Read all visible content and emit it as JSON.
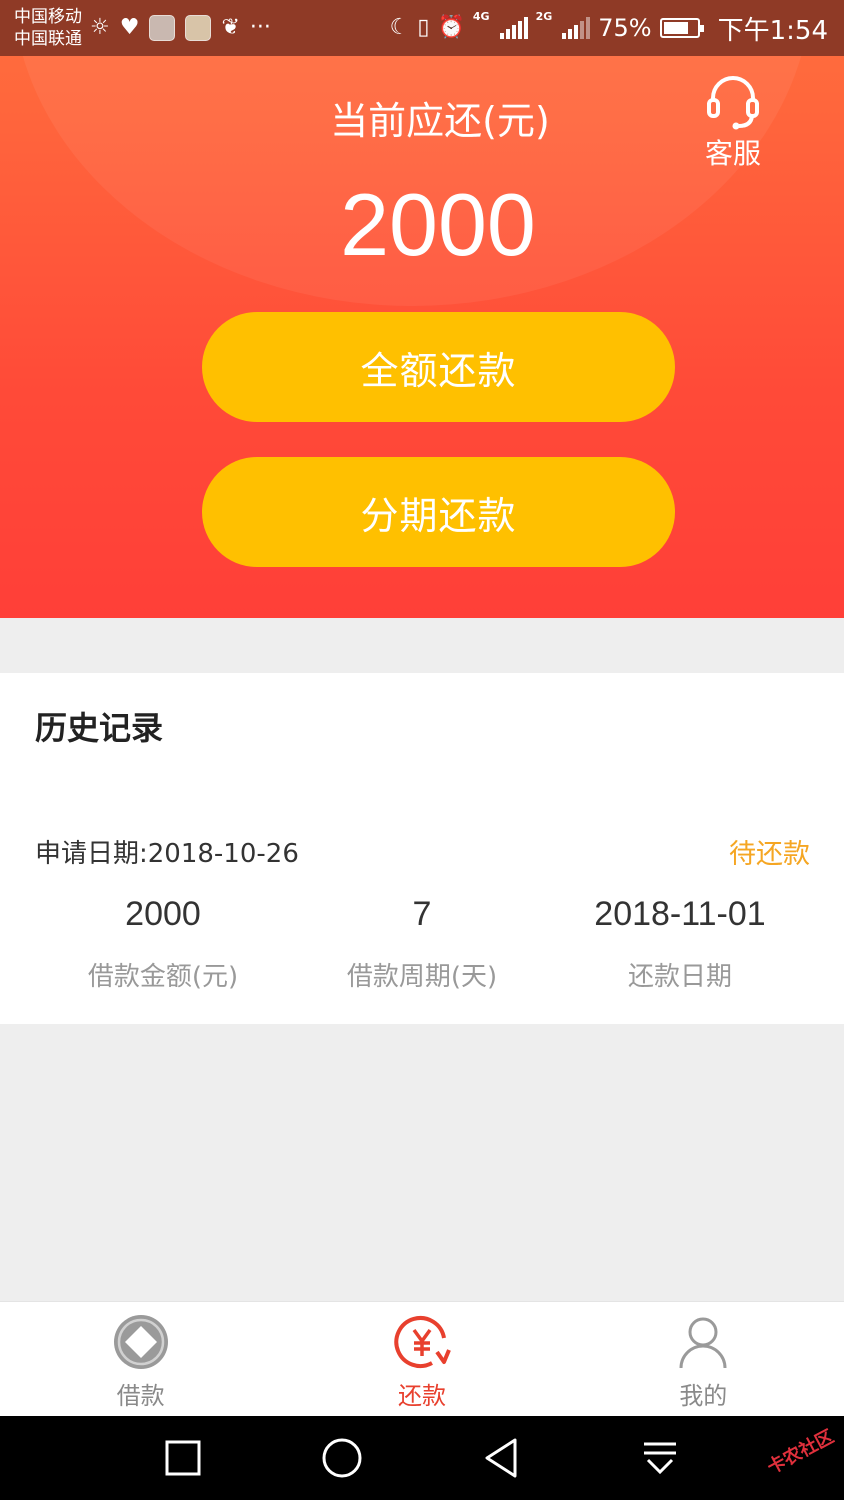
{
  "status_bar": {
    "carrier_1": "中国移动",
    "carrier_2": "中国联通",
    "network_1": "4G",
    "network_2": "2G",
    "battery_percent": "75%",
    "battery_level": 0.75,
    "time": "下午1:54",
    "more": "···",
    "icons": [
      "brightness-icon",
      "heart-rate-icon",
      "app-icon",
      "app-icon",
      "uc-browser-icon",
      "more-icon",
      "moon-icon",
      "vibrate-icon",
      "alarm-icon",
      "signal-icon",
      "battery-icon"
    ]
  },
  "header": {
    "label": "当前应还(元)",
    "amount": "2000",
    "service_label": "客服",
    "service_icon": "headset-icon"
  },
  "buttons": {
    "full_repay": "全额还款",
    "installment_repay": "分期还款"
  },
  "history": {
    "title": "历史记录",
    "records": [
      {
        "apply_date": "申请日期:2018-10-26",
        "status": "待还款",
        "amount": "2000",
        "amount_label": "借款金额(元)",
        "period": "7",
        "period_label": "借款周期(天)",
        "due_date": "2018-11-01",
        "due_date_label": "还款日期"
      }
    ]
  },
  "tabbar": {
    "tabs": [
      {
        "label": "借款",
        "icon": "diamond-coin-icon",
        "active": false
      },
      {
        "label": "还款",
        "icon": "yuan-repay-icon",
        "active": true
      },
      {
        "label": "我的",
        "icon": "person-icon",
        "active": false
      }
    ]
  },
  "navbar": {
    "buttons": [
      "recent-apps-icon",
      "home-icon",
      "back-icon",
      "notification-pull-icon"
    ],
    "watermark": "卡农社区"
  },
  "colors": {
    "header_top": "#ff6b3d",
    "header_bottom": "#ff3f38",
    "button": "#ffc000",
    "status_pending": "#f5a623",
    "tab_active": "#e8402e",
    "tab_inactive": "#8a8a8a"
  }
}
